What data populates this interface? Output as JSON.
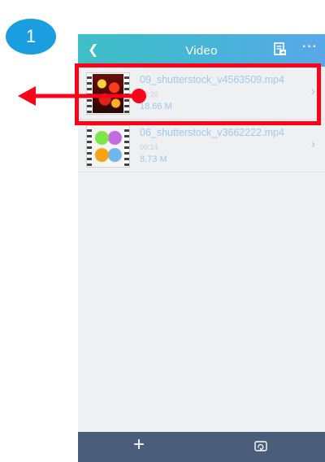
{
  "step": {
    "number": "1"
  },
  "navbar": {
    "back_icon": "chevron-left-icon",
    "title": "Video",
    "doc_icon": "document-export-icon",
    "more_label": "···"
  },
  "files": [
    {
      "name": "09_shutterstock_v4563509.mp4",
      "duration": "00:20",
      "size": "18.66 M",
      "thumb": "fireworks-thumbnail"
    },
    {
      "name": "06_shutterstock_v3662222.mp4",
      "duration": "00:14",
      "size": "8.73 M",
      "thumb": "paint-cans-thumbnail"
    }
  ],
  "tabbar": {
    "add_label": "+",
    "repeat_icon": "repeat-icon"
  },
  "annotation": {
    "highlight_color": "#ff0019",
    "arrow_direction": "left",
    "highlighted_item": "files.0"
  },
  "colors": {
    "accent": "#1a9ee0",
    "navbar_start": "#3fbfc6",
    "navbar_end": "#58a8e8",
    "tabbar": "#4a5d7a",
    "filename": "#9fc9ea"
  }
}
